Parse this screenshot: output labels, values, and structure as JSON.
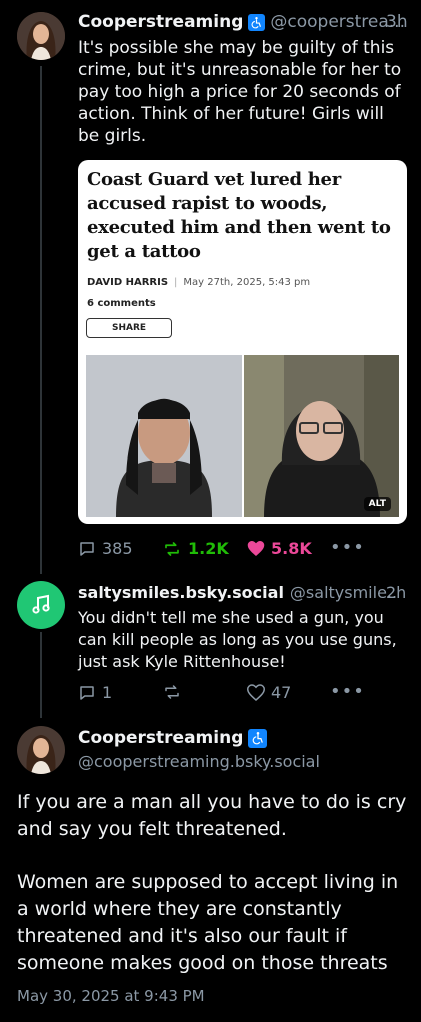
{
  "post1": {
    "name": "Cooperstreaming",
    "handle": "@cooperstrea...",
    "time": "3h",
    "text": "It's possible she may be guilty of this crime, but it's unreasonable for her to pay too high a price for 20 seconds of action. Think of her future! Girls will be girls.",
    "card": {
      "headline": "Coast Guard vet lured her accused rapist to woods, executed him and then went to get a tattoo",
      "author": "DAVID HARRIS",
      "date": "May 27th, 2025, 5:43 pm",
      "comments": "6 comments",
      "share": "SHARE",
      "alt": "ALT"
    },
    "replies": "385",
    "reposts": "1.2K",
    "likes": "5.8K"
  },
  "post2": {
    "name": "saltysmiles.bsky.social",
    "handle": "@saltysmile..",
    "time": "2h",
    "text": "You didn't tell me she used a gun, you can kill people as long as you use guns, just ask Kyle Rittenhouse!",
    "replies": "1",
    "likes": "47"
  },
  "post3": {
    "name": "Cooperstreaming",
    "handle": "@cooperstreaming.bsky.social",
    "para1": "If you are a man all you have to do is cry and say you felt threatened.",
    "para2": "Women are supposed to accept living in a world where they are constantly threatened and it's also our fault if someone makes good on those threats",
    "timestamp": "May 30, 2025 at 9:43 PM"
  },
  "colors": {
    "accessibility_badge": "#1185fe",
    "repost_active": "#20bc07",
    "like_active": "#ec4899",
    "avatar_green": "#20c774"
  }
}
